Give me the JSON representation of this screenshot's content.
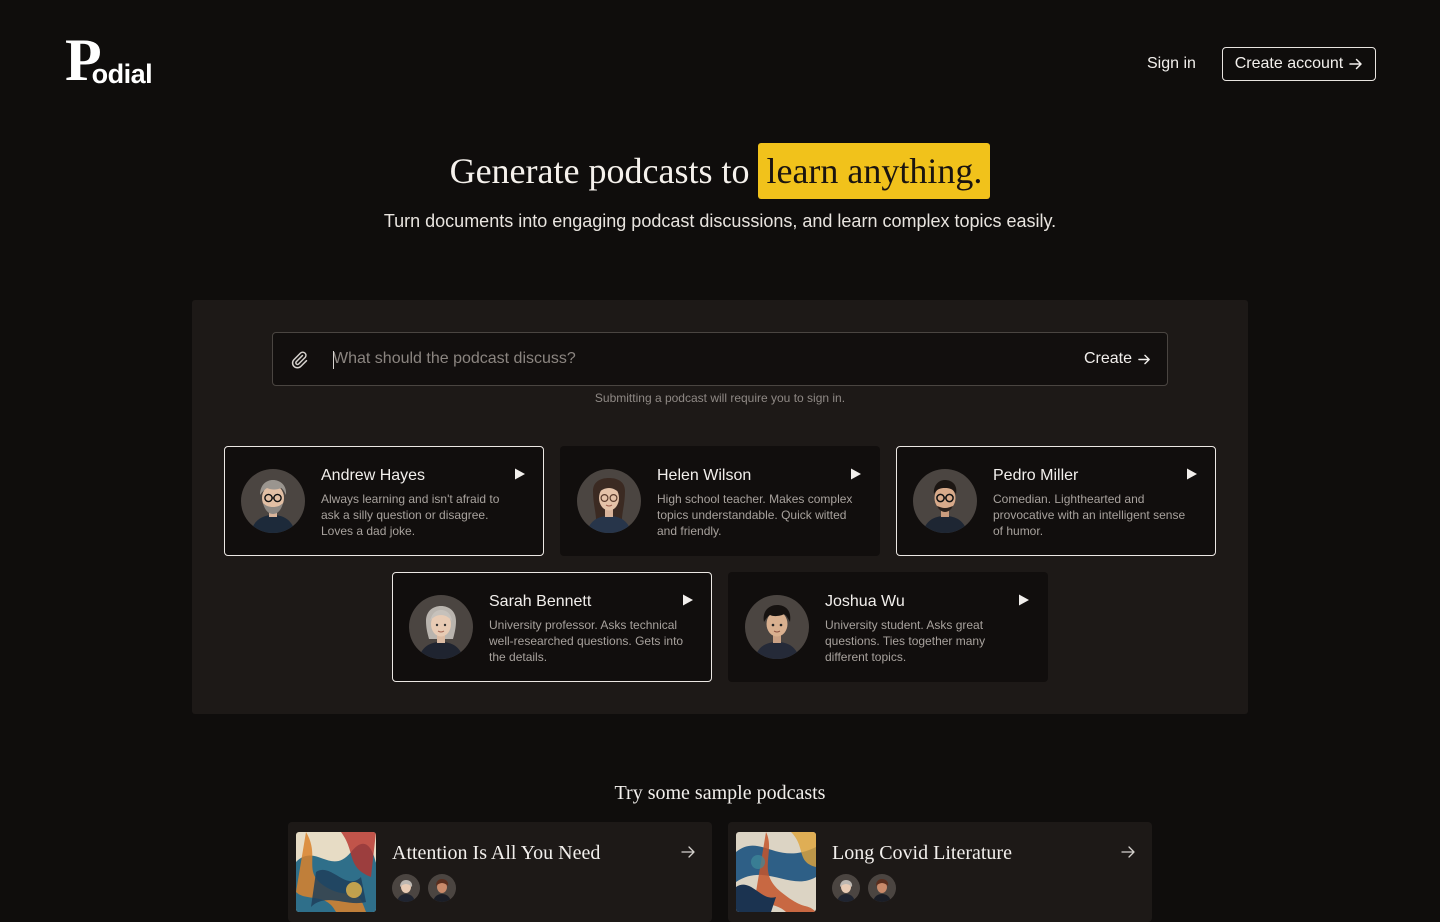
{
  "header": {
    "logo": {
      "initial": "P",
      "rest": "odial"
    },
    "signin_label": "Sign in",
    "create_account_label": "Create account"
  },
  "hero": {
    "title_lead": "Generate podcasts to",
    "title_highlight": "learn anything.",
    "subtitle": "Turn documents into engaging podcast discussions, and learn complex topics easily."
  },
  "composer": {
    "placeholder": "What should the podcast discuss?",
    "value": "",
    "create_label": "Create",
    "hint": "Submitting a podcast will require you to sign in."
  },
  "hosts": [
    {
      "name": "Andrew Hayes",
      "description": "Always learning and isn't afraid to ask a silly question or disagree. Loves a dad joke.",
      "selected": true
    },
    {
      "name": "Helen Wilson",
      "description": "High school teacher. Makes complex topics understandable. Quick witted and friendly.",
      "selected": false
    },
    {
      "name": "Pedro Miller",
      "description": "Comedian. Lighthearted and provocative with an intelligent sense of humor.",
      "selected": true
    },
    {
      "name": "Sarah Bennett",
      "description": "University professor. Asks technical well-researched questions. Gets into the details.",
      "selected": true
    },
    {
      "name": "Joshua Wu",
      "description": "University student. Asks great questions. Ties together many different topics.",
      "selected": false
    }
  ],
  "samples": {
    "heading": "Try some sample podcasts",
    "items": [
      {
        "title": "Attention Is All You Need"
      },
      {
        "title": "Long Covid Literature"
      }
    ]
  },
  "colors": {
    "background": "#0f0d0c",
    "panel": "#1d1917",
    "highlight": "#f1c21b",
    "text": "#f2efec",
    "muted": "#a8a29d"
  }
}
